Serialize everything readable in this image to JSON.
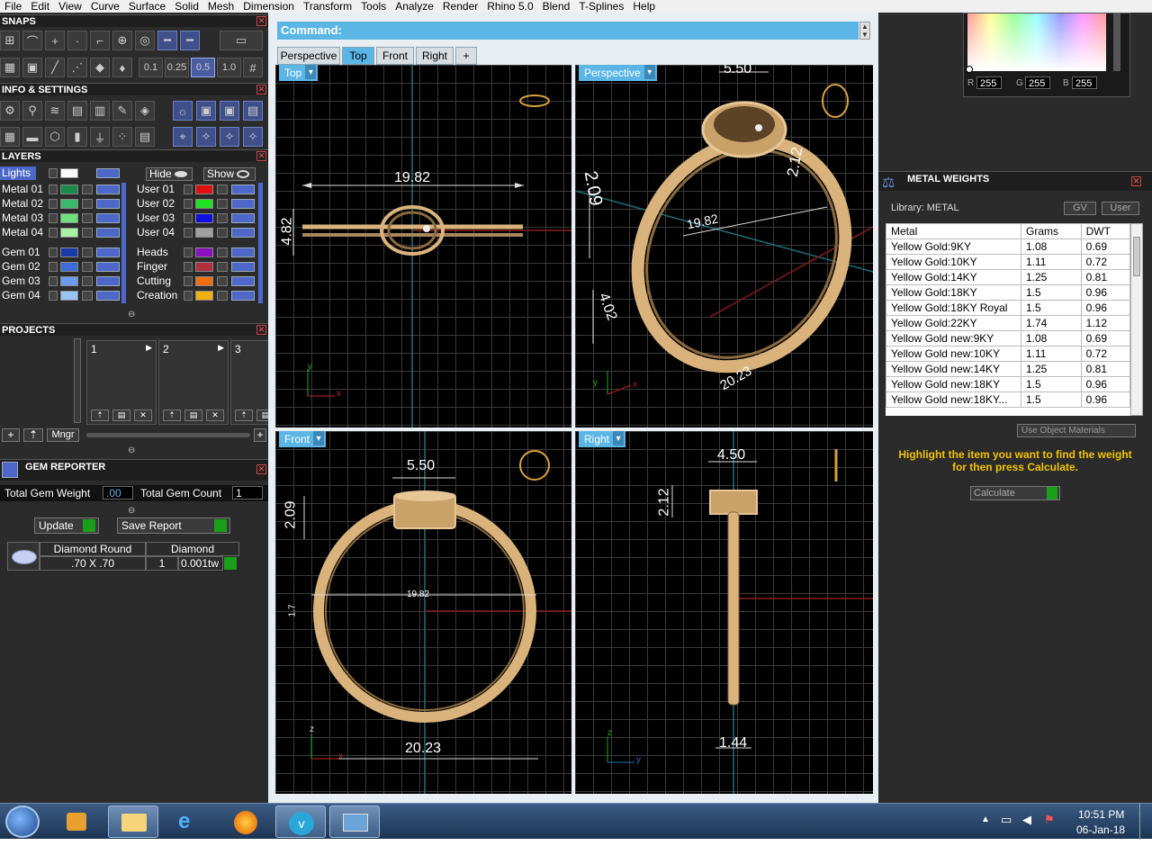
{
  "menu": [
    "File",
    "Edit",
    "View",
    "Curve",
    "Surface",
    "Solid",
    "Mesh",
    "Dimension",
    "Transform",
    "Tools",
    "Analyze",
    "Render",
    "Rhino 5.0",
    "Blend",
    "T-Splines",
    "Help"
  ],
  "panels": {
    "snaps": "SNAPS",
    "info": "INFO & SETTINGS",
    "layers": "LAYERS",
    "projects": "PROJECTS",
    "gem_reporter": "GEM REPORTER"
  },
  "snap_values": [
    "0.1",
    "0.25",
    "0.5",
    "1.0"
  ],
  "layers": {
    "lights": "Lights",
    "hide": "Hide",
    "show": "Show",
    "left": [
      {
        "name": "Metal 01",
        "color": "#1a8a4a"
      },
      {
        "name": "Metal 02",
        "color": "#3bb96a"
      },
      {
        "name": "Metal 03",
        "color": "#6fe07a"
      },
      {
        "name": "Metal 04",
        "color": "#a8f0a8"
      },
      {
        "name": "Gem 01",
        "color": "#1a3aa8"
      },
      {
        "name": "Gem 02",
        "color": "#3d6cd8"
      },
      {
        "name": "Gem 03",
        "color": "#6a9cf0"
      },
      {
        "name": "Gem 04",
        "color": "#9ac4f5"
      }
    ],
    "right": [
      {
        "name": "User 01",
        "color": "#e01010"
      },
      {
        "name": "User 02",
        "color": "#20e020"
      },
      {
        "name": "User 03",
        "color": "#1010e0"
      },
      {
        "name": "User 04",
        "color": "#a0a0a0"
      },
      {
        "name": "Heads",
        "color": "#8a10c0"
      },
      {
        "name": "Finger",
        "color": "#b03040"
      },
      {
        "name": "Cutting",
        "color": "#f07010"
      },
      {
        "name": "Creation",
        "color": "#f0b010"
      }
    ]
  },
  "projects": {
    "slots": [
      "1",
      "2",
      "3"
    ],
    "mngr": "Mngr"
  },
  "gem_reporter": {
    "total_weight_label": "Total Gem Weight",
    "total_weight": ".00",
    "total_count_label": "Total Gem Count",
    "total_count": "1",
    "update": "Update",
    "save_report": "Save Report",
    "gem_name": "Diamond Round",
    "gem_size": ".70 X .70",
    "gem_type": "Diamond",
    "gem_qty": "1",
    "gem_tw": "0.001tw"
  },
  "command": {
    "label": "Command:"
  },
  "tabs": [
    "Perspective",
    "Top",
    "Front",
    "Right",
    "+"
  ],
  "viewports": {
    "top": {
      "label": "Top",
      "dims": [
        "19.82",
        "4.82"
      ]
    },
    "perspective": {
      "label": "Perspective",
      "dims": [
        "5.50",
        "2.09",
        "2.12",
        "19.82",
        "4.02",
        "20.23"
      ]
    },
    "front": {
      "label": "Front",
      "dims": [
        "5.50",
        "2.09",
        "19.82",
        "1.7",
        "20.23"
      ]
    },
    "right": {
      "label": "Right",
      "dims": [
        "4.50",
        "2.12",
        "1.44"
      ]
    }
  },
  "color_picker": {
    "r": "255",
    "g": "255",
    "b": "255",
    "r_label": "R",
    "g_label": "G",
    "b_label": "B"
  },
  "metal_weights": {
    "title": "METAL WEIGHTS",
    "library": "Library: METAL",
    "gv": "GV",
    "user": "User",
    "columns": [
      "Metal",
      "Grams",
      "DWT"
    ],
    "rows": [
      [
        "Yellow Gold:9KY",
        "1.08",
        "0.69"
      ],
      [
        "Yellow Gold:10KY",
        "1.11",
        "0.72"
      ],
      [
        "Yellow Gold:14KY",
        "1.25",
        "0.81"
      ],
      [
        "Yellow Gold:18KY",
        "1.5",
        "0.96"
      ],
      [
        "Yellow Gold:18KY Royal",
        "1.5",
        "0.96"
      ],
      [
        "Yellow Gold:22KY",
        "1.74",
        "1.12"
      ],
      [
        "Yellow Gold new:9KY",
        "1.08",
        "0.69"
      ],
      [
        "Yellow Gold new:10KY",
        "1.11",
        "0.72"
      ],
      [
        "Yellow Gold new:14KY",
        "1.25",
        "0.81"
      ],
      [
        "Yellow Gold new:18KY",
        "1.5",
        "0.96"
      ],
      [
        "Yellow Gold new:18KY...",
        "1.5",
        "0.96"
      ]
    ],
    "use_object_materials": "Use Object Materials",
    "hint": "Highlight the item you want to find the weight for then press Calculate.",
    "calculate": "Calculate"
  },
  "clock": {
    "time": "10:51 PM",
    "date": "06-Jan-18"
  },
  "colors": {
    "accent": "#5bb6e6",
    "gold": "#d9b27c",
    "hint": "#f2c200"
  }
}
